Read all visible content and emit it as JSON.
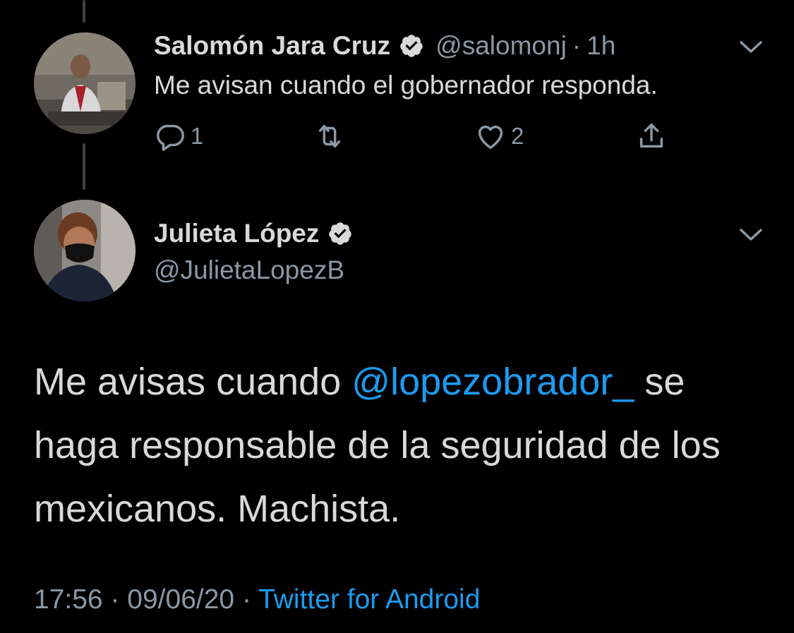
{
  "colors": {
    "background": "#000000",
    "primary_text": "#d9d9d9",
    "secondary_text": "#8b98a5",
    "link": "#1d9bf0"
  },
  "reply_tweet": {
    "display_name": "Salomón Jara Cruz",
    "handle": "@salomonj",
    "separator": "·",
    "time": "1h",
    "text": "Me avisan cuando el gobernador responda.",
    "reply_count": "1",
    "like_count": "2",
    "icons": [
      "reply-icon",
      "retweet-icon",
      "like-icon",
      "share-icon",
      "verified-badge-icon",
      "chevron-down-icon"
    ]
  },
  "main_tweet": {
    "display_name": "Julieta López",
    "handle": "@JulietaLopezB",
    "text_before": "Me avisas cuando ",
    "mention": "@lopezobrador_",
    "text_after": " se haga responsable de la seguridad de los mexicanos. Machista.",
    "time": "17:56",
    "separator_1": "·",
    "date": "09/06/20",
    "separator_2": "·",
    "source": "Twitter for Android"
  }
}
